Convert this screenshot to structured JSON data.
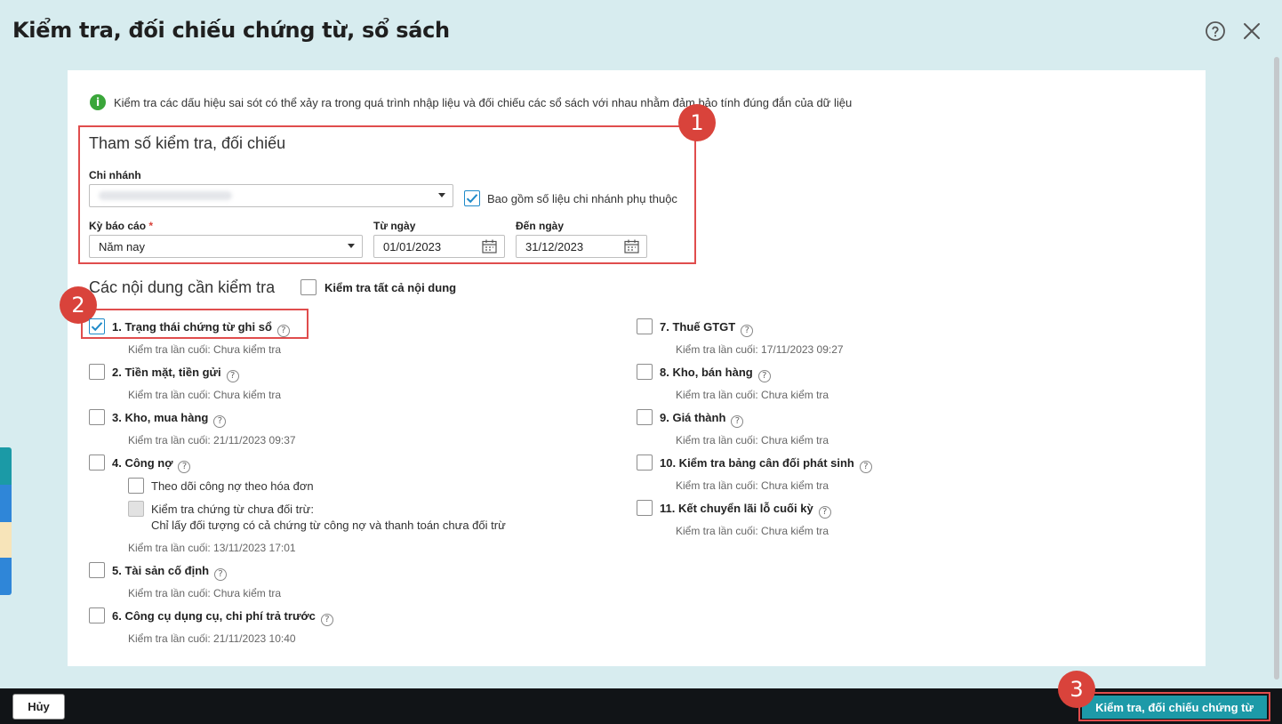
{
  "dialog": {
    "title": "Kiểm tra, đối chiếu chứng từ, sổ sách",
    "help_icon": "question-circle-icon",
    "close_icon": "close-icon"
  },
  "info": {
    "icon": "info-icon",
    "icon_glyph": "i",
    "text": "Kiểm tra các dấu hiệu sai sót có thể xảy ra trong quá trình nhập liệu và đối chiếu các sổ sách với nhau nhằm đảm bảo tính đúng đắn của dữ liệu"
  },
  "badges": {
    "one": "1",
    "two": "2",
    "three": "3"
  },
  "params": {
    "title": "Tham số kiểm tra, đối chiếu",
    "branch_label": "Chi nhánh",
    "include_sub_label": "Bao gồm số liệu chi nhánh phụ thuộc",
    "include_sub_checked": true,
    "period_label": "Kỳ báo cáo",
    "required_mark": "*",
    "period_value": "Năm nay",
    "from_label": "Từ ngày",
    "from_value": "01/01/2023",
    "to_label": "Đến ngày",
    "to_value": "31/12/2023"
  },
  "checks": {
    "title": "Các nội dung cần kiểm tra",
    "check_all_label": "Kiểm tra tất cả nội dung",
    "help_glyph": "?",
    "items": [
      {
        "label": "1. Trạng thái chứng từ ghi sổ",
        "checked": true,
        "last": "Kiểm tra lần cuối: Chưa kiểm tra"
      },
      {
        "label": "2. Tiền mặt, tiền gửi",
        "checked": false,
        "last": "Kiểm tra lần cuối: Chưa kiểm tra"
      },
      {
        "label": "3. Kho, mua hàng",
        "checked": false,
        "last": "Kiểm tra lần cuối: 21/11/2023 09:37"
      },
      {
        "label": "4. Công nợ",
        "checked": false,
        "last": "Kiểm tra lần cuối: 13/11/2023 17:01"
      },
      {
        "label": "5. Tài sản cố định",
        "checked": false,
        "last": "Kiểm tra lần cuối: Chưa kiểm tra"
      },
      {
        "label": "6. Công cụ dụng cụ, chi phí trả trước",
        "checked": false,
        "last": "Kiểm tra lần cuối: 21/11/2023 10:40"
      },
      {
        "label": "7. Thuế GTGT",
        "checked": false,
        "last": "Kiểm tra lần cuối: 17/11/2023 09:27"
      },
      {
        "label": "8. Kho, bán hàng",
        "checked": false,
        "last": "Kiểm tra lần cuối: Chưa kiểm tra"
      },
      {
        "label": "9. Giá thành",
        "checked": false,
        "last": "Kiểm tra lần cuối: Chưa kiểm tra"
      },
      {
        "label": "10. Kiểm tra bảng cân đối phát sinh",
        "checked": false,
        "last": "Kiểm tra lần cuối: Chưa kiểm tra"
      },
      {
        "label": "11. Kết chuyển lãi lỗ cuối kỳ",
        "checked": false,
        "last": "Kiểm tra lần cuối: Chưa kiểm tra"
      }
    ],
    "debt_options": {
      "by_invoice": "Theo dõi công nợ theo hóa đơn",
      "unmatched_line1": "Kiểm tra chứng từ chưa đối trừ:",
      "unmatched_line2": "Chỉ lấy đối tượng có cả chứng từ công nợ và thanh toán chưa đối trừ"
    }
  },
  "footer": {
    "cancel_label": "Hủy",
    "submit_label": "Kiểm tra, đối chiếu chứng từ"
  },
  "colors": {
    "accent": "#1d9aa8",
    "highlight": "#e04d4d",
    "background": "#d7ecef"
  }
}
